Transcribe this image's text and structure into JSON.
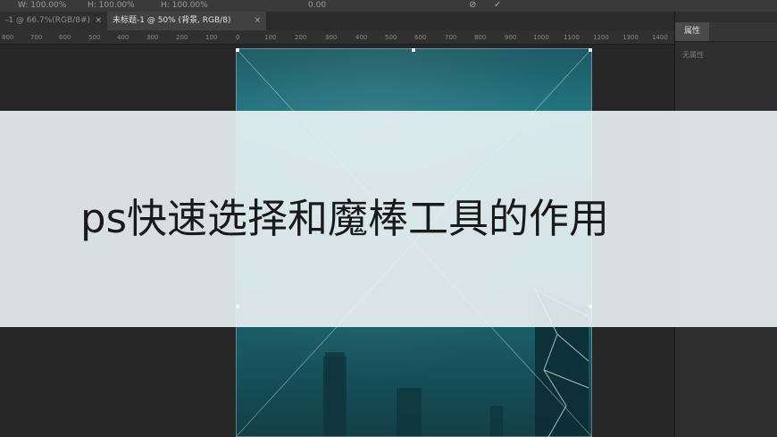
{
  "options_bar": {
    "items": [
      "W: 100.00%",
      "H: 100.00%",
      "H: 100.00%",
      "0.00"
    ]
  },
  "tabs": [
    {
      "label": "-1 @ 66.7%(RGB/8#)",
      "close": "×"
    },
    {
      "label": "未标题-1 @ 50% (背景, RGB/8)",
      "close": "×"
    }
  ],
  "ruler": {
    "ticks": [
      "800",
      "700",
      "600",
      "500",
      "400",
      "300",
      "200",
      "100",
      "0",
      "100",
      "200",
      "300",
      "400",
      "500",
      "600",
      "700",
      "800",
      "900",
      "1000",
      "1100",
      "1200",
      "1300",
      "1400"
    ]
  },
  "properties_panel": {
    "tab_label": "属性",
    "empty_text": "无属性"
  },
  "article": {
    "title": "ps快速选择和魔棒工具的作用"
  },
  "colors": {
    "app_background": "#262626",
    "image_teal": "#237784",
    "banner_overlay": "#ecf4f6"
  }
}
